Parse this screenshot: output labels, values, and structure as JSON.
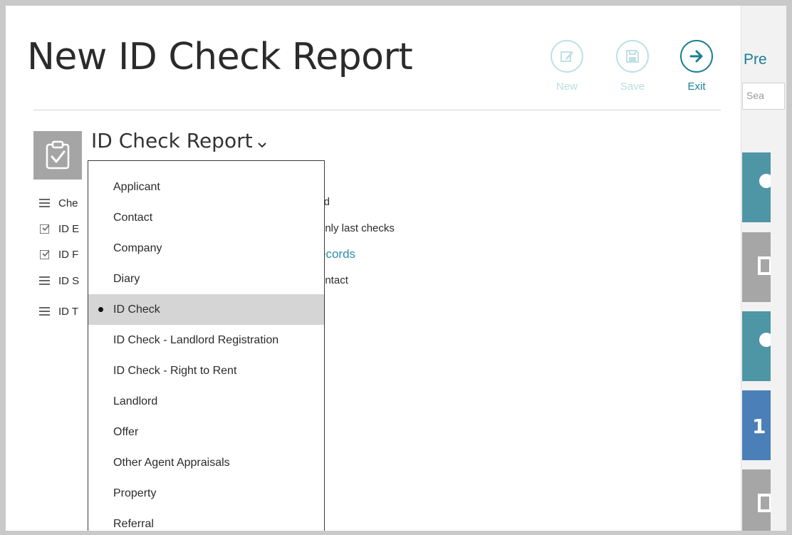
{
  "header": {
    "title": "New ID Check Report",
    "toolbar": {
      "new_label": "New",
      "save_label": "Save",
      "exit_label": "Exit"
    }
  },
  "report": {
    "selector_label": "ID Check Report",
    "fields": [
      {
        "label": "Che",
        "icon": "hamburger-icon"
      },
      {
        "label": "ID E",
        "icon": "checkbox-icon"
      },
      {
        "label": "ID F",
        "icon": "checkbox-icon"
      },
      {
        "label": "ID S",
        "icon": "hamburger-icon"
      },
      {
        "label": "ID T",
        "icon": "hamburger-icon"
      }
    ],
    "right_column": {
      "valid_text": "lid",
      "only_last_checks": "only last checks",
      "records_link": "ecords",
      "contact_text": "ontact"
    }
  },
  "dropdown": {
    "selected": "ID Check",
    "items": [
      "Applicant",
      "Contact",
      "Company",
      "Diary",
      "ID Check",
      "ID Check - Landlord Registration",
      "ID Check - Right to Rent",
      "Landlord",
      "Offer",
      "Other Agent Appraisals",
      "Property",
      "Referral"
    ]
  },
  "right_panel": {
    "title": "Pre",
    "search_placeholder": "Sea",
    "tile_glyphs": [
      "",
      "",
      "",
      "1",
      ""
    ]
  },
  "colors": {
    "accent": "#1a7f96",
    "accent_disabled": "#bfe0e6",
    "link": "#2e8ea6",
    "tile_teal": "#4e96a6",
    "tile_grey": "#a6a6a6",
    "tile_blue": "#4a7fb8",
    "selected_row": "#d5d5d5"
  }
}
